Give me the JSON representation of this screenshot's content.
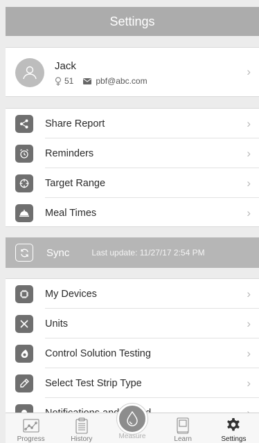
{
  "header": {
    "title": "Settings"
  },
  "profile": {
    "name": "Jack",
    "age": "51",
    "email": "pbf@abc.com"
  },
  "section1": {
    "items": [
      {
        "label": "Share Report",
        "icon": "share-icon"
      },
      {
        "label": "Reminders",
        "icon": "alarm-clock-icon"
      },
      {
        "label": "Target Range",
        "icon": "target-icon"
      },
      {
        "label": "Meal Times",
        "icon": "meal-cloche-icon"
      }
    ]
  },
  "sync": {
    "label": "Sync",
    "last_update": "Last update: 11/27/17 2:54 PM"
  },
  "section2": {
    "items": [
      {
        "label": "My Devices",
        "icon": "chip-icon"
      },
      {
        "label": "Units",
        "icon": "arrows-icon"
      },
      {
        "label": "Control Solution Testing",
        "icon": "drop-icon"
      },
      {
        "label": "Select Test Strip Type",
        "icon": "test-strip-icon"
      },
      {
        "label": "Notifications and Sound",
        "icon": "bell-icon"
      }
    ]
  },
  "tabbar": {
    "tabs": [
      {
        "label": "Progress"
      },
      {
        "label": "History"
      },
      {
        "label": "Measure"
      },
      {
        "label": "Learn"
      },
      {
        "label": "Settings"
      }
    ],
    "active": "Settings"
  },
  "colors": {
    "header": "#acacac",
    "sync_bar": "#b6b6b6",
    "icon_bg": "#6f6f6f",
    "background": "#ececec"
  }
}
